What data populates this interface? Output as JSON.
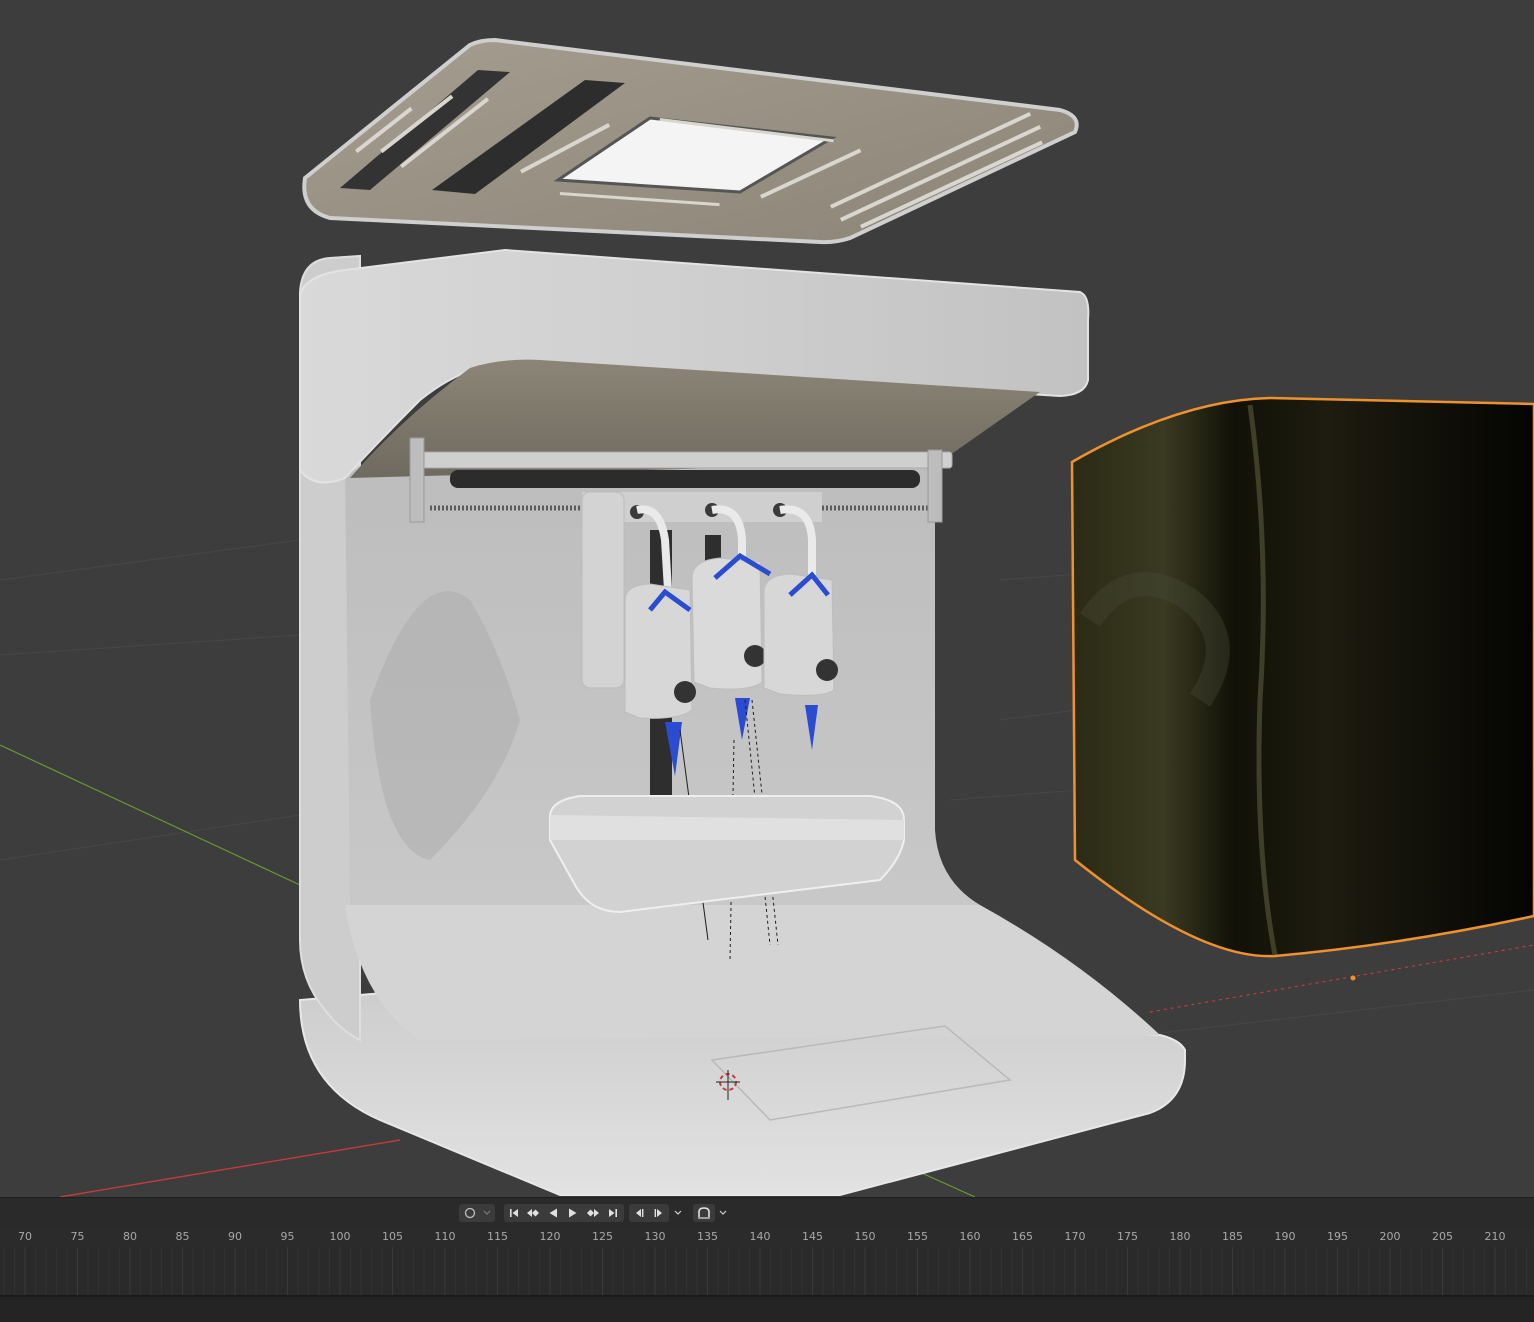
{
  "scene": {
    "printer_body_color": "#c9c9c9",
    "lid_color": "#9a9184",
    "selection_outline_color": "#f0922c",
    "axis_x_color": "#c33b3b",
    "axis_y_color": "#6a9a2e",
    "dispenser_accent_color": "#2a4cd0",
    "background_color": "#3d3d3d"
  },
  "timeline": {
    "transport": {
      "record_icon": "record-circle-icon",
      "jump_start_icon": "jump-to-start-icon",
      "prev_keyframe_icon": "previous-keyframe-icon",
      "play_reverse_icon": "play-reverse-icon",
      "play_icon": "play-icon",
      "next_keyframe_icon": "next-keyframe-icon",
      "jump_end_icon": "jump-to-end-icon",
      "step_back_icon": "step-back-icon",
      "step_forward_icon": "step-forward-icon",
      "snap_icon": "snap-magnet-icon"
    },
    "frame_labels": [
      "70",
      "75",
      "80",
      "85",
      "90",
      "95",
      "100",
      "105",
      "110",
      "115",
      "120",
      "125",
      "130",
      "135",
      "140",
      "145",
      "150",
      "155",
      "160",
      "165",
      "170",
      "175",
      "180",
      "185",
      "190",
      "195",
      "200",
      "205",
      "210"
    ]
  }
}
